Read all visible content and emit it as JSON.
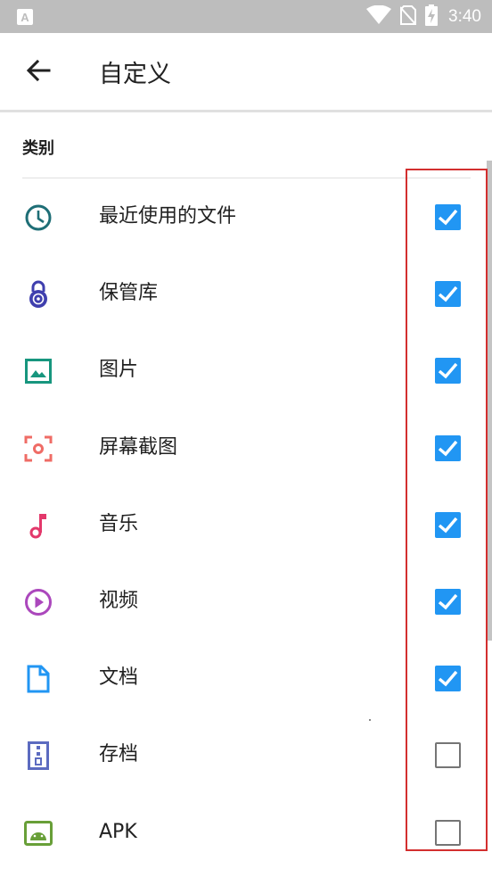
{
  "status_bar": {
    "time": "3:40",
    "icons": [
      "notification-a-icon",
      "wifi-icon",
      "no-sim-icon",
      "battery-charging-icon"
    ]
  },
  "app_bar": {
    "back_icon": "arrow-back-icon",
    "title": "自定义"
  },
  "section": {
    "header": "类别"
  },
  "categories": [
    {
      "label": "最近使用的文件",
      "icon": "clock-icon",
      "color": "#1e6e76",
      "checked": true
    },
    {
      "label": "保管库",
      "icon": "vault-lock-icon",
      "color": "#3f3fae",
      "checked": true
    },
    {
      "label": "图片",
      "icon": "image-icon",
      "color": "#17967e",
      "checked": true
    },
    {
      "label": "屏幕截图",
      "icon": "screenshot-icon",
      "color": "#ef6c66",
      "checked": true
    },
    {
      "label": "音乐",
      "icon": "music-note-icon",
      "color": "#e3386b",
      "checked": true
    },
    {
      "label": "视频",
      "icon": "play-circle-icon",
      "color": "#ab47bc",
      "checked": true
    },
    {
      "label": "文档",
      "icon": "document-icon",
      "color": "#2196f3",
      "checked": true
    },
    {
      "label": "存档",
      "icon": "archive-icon",
      "color": "#5c6bc0",
      "checked": false
    },
    {
      "label": "APK",
      "icon": "android-icon",
      "color": "#689f38",
      "checked": false
    }
  ],
  "colors": {
    "checkbox_checked": "#2196f3",
    "highlight": "#d32f2f",
    "status_bar": "#bdbdbd"
  }
}
